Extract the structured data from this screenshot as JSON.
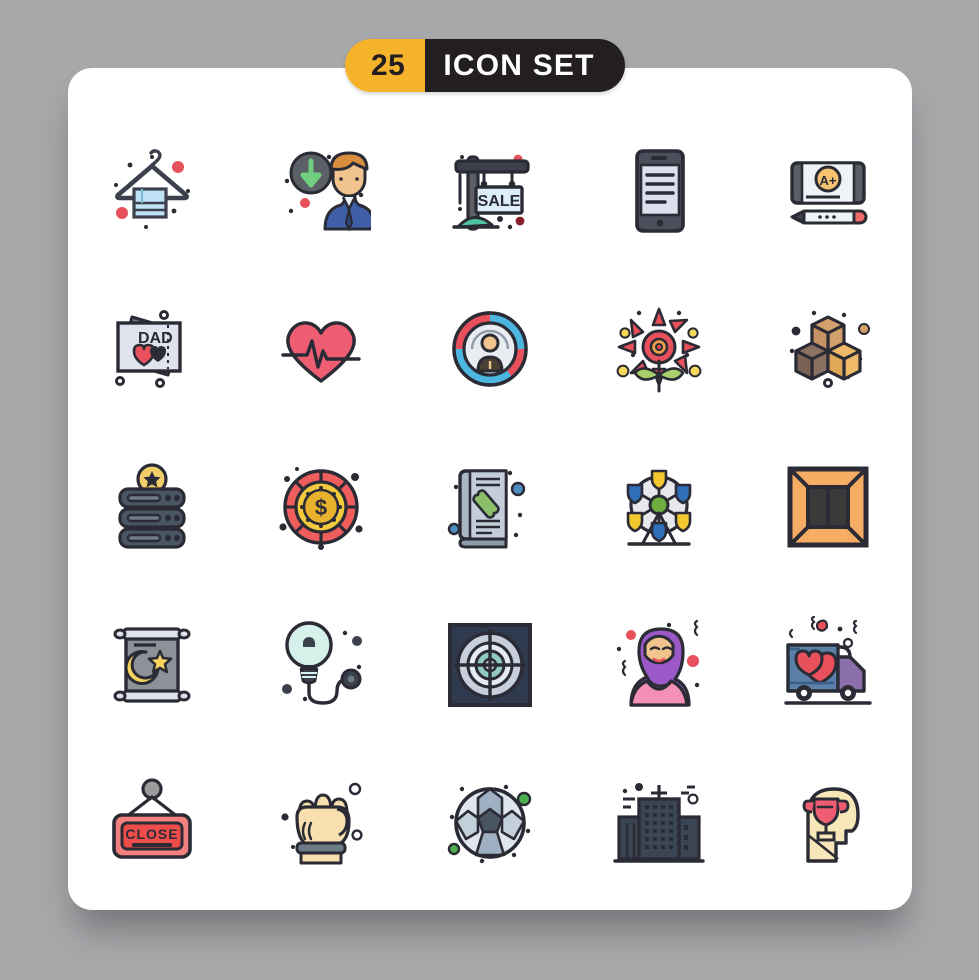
{
  "background_color": "#a7a8aa",
  "card": {
    "background": "#ffffff",
    "corner_radius_px": 24
  },
  "header": {
    "count": "25",
    "title": "Icon Set",
    "title_display": "ICON SET",
    "count_bg": "#f5b32b",
    "title_bg": "#231f20",
    "count_text_color": "#231f20",
    "title_text_color": "#ffffff"
  },
  "style": {
    "name": "Filled Line",
    "stroke_color": "#2b2b35",
    "stroke_width": 2.2
  },
  "grid": {
    "columns": 5,
    "rows": 5,
    "total_icons": 25
  },
  "icons": [
    {
      "id": 1,
      "row": 1,
      "col": 1,
      "name": "hanger-towel-icon",
      "label": "Hanger with Towel",
      "colors": [
        "#3c3f4c",
        "#bfe3f5",
        "#e8505b"
      ]
    },
    {
      "id": 2,
      "row": 1,
      "col": 2,
      "name": "download-businessman-icon",
      "label": "Download Businessman",
      "colors": [
        "#5b6066",
        "#6fcf7e",
        "#3f5fa8",
        "#f2b07b",
        "#e8505b"
      ]
    },
    {
      "id": 3,
      "row": 1,
      "col": 3,
      "name": "sale-signboard-icon",
      "label": "Sale Signboard",
      "sign_text": "SALE",
      "colors": [
        "#3c3f4c",
        "#ddeefb",
        "#4fc3a1"
      ]
    },
    {
      "id": 4,
      "row": 1,
      "col": 4,
      "name": "smartphone-icon",
      "label": "Smartphone Document",
      "colors": [
        "#4a4f5c",
        "#dcdfee"
      ]
    },
    {
      "id": 5,
      "row": 1,
      "col": 5,
      "name": "grade-card-pencil-icon",
      "label": "A+ Grade Card with Pencil",
      "card_text": "A+",
      "colors": [
        "#5b6066",
        "#eef3f7",
        "#f5c271",
        "#e8505b"
      ]
    },
    {
      "id": 6,
      "row": 2,
      "col": 1,
      "name": "dad-card-icon",
      "label": "Dad Card with Hearts",
      "card_text": "DAD",
      "colors": [
        "#5b6066",
        "#dfe3ee",
        "#e8505b"
      ]
    },
    {
      "id": 7,
      "row": 2,
      "col": 2,
      "name": "heartbeat-icon",
      "label": "Heartbeat Pulse",
      "colors": [
        "#ef5d72",
        "#2b2b35"
      ]
    },
    {
      "id": 8,
      "row": 2,
      "col": 3,
      "name": "user-donut-chart-icon",
      "label": "User Profile Chart",
      "colors": [
        "#e8505b",
        "#4bb7e0",
        "#e9edf2",
        "#f2c48d",
        "#4a3f33"
      ]
    },
    {
      "id": 9,
      "row": 2,
      "col": 4,
      "name": "flower-icon",
      "label": "Flower",
      "colors": [
        "#e8505b",
        "#a8cf6a",
        "#f5d958"
      ]
    },
    {
      "id": 10,
      "row": 2,
      "col": 5,
      "name": "sugar-cubes-icon",
      "label": "Sugar Cubes Blocks",
      "colors": [
        "#d2a06a",
        "#f0b96a",
        "#8a7263"
      ]
    },
    {
      "id": 11,
      "row": 3,
      "col": 1,
      "name": "server-star-coin-icon",
      "label": "Server with Star Coin",
      "colors": [
        "#4a5563",
        "#6d7a88",
        "#f2cf6a"
      ]
    },
    {
      "id": 12,
      "row": 3,
      "col": 2,
      "name": "casino-chip-dollar-icon",
      "label": "Casino Chip Dollar",
      "colors": [
        "#ef5d5d",
        "#f3ca3e",
        "#e8b12e"
      ]
    },
    {
      "id": 13,
      "row": 3,
      "col": 3,
      "name": "phone-directory-icon",
      "label": "Phone Directory Book",
      "colors": [
        "#aab6c4",
        "#8e9bab",
        "#8bbf6a",
        "#4f8fc0"
      ]
    },
    {
      "id": 14,
      "row": 3,
      "col": 4,
      "name": "ferris-wheel-icon",
      "label": "Ferris Wheel",
      "colors": [
        "#e6e8ec",
        "#f3c72e",
        "#2f6fba",
        "#6dae3f"
      ]
    },
    {
      "id": 15,
      "row": 3,
      "col": 5,
      "name": "window-frame-icon",
      "label": "Window Frame",
      "colors": [
        "#f5ac63",
        "#3a3a3a"
      ]
    },
    {
      "id": 16,
      "row": 4,
      "col": 1,
      "name": "ramadan-scroll-icon",
      "label": "Moon Star Scroll",
      "colors": [
        "#8d9198",
        "#dfe4ec",
        "#f5d45e"
      ]
    },
    {
      "id": 17,
      "row": 4,
      "col": 2,
      "name": "light-bulb-plug-icon",
      "label": "Light Bulb with Plug",
      "colors": [
        "#d6f0ea",
        "#3c3f4c"
      ]
    },
    {
      "id": 18,
      "row": 4,
      "col": 3,
      "name": "radar-target-icon",
      "label": "Radar Target Screen",
      "colors": [
        "#2f3a4e",
        "#c6cfdb",
        "#8fcbc0"
      ]
    },
    {
      "id": 19,
      "row": 4,
      "col": 4,
      "name": "hijab-woman-icon",
      "label": "Woman in Hijab",
      "colors": [
        "#9b59c8",
        "#f48fb6",
        "#f2c48d",
        "#e8505b"
      ]
    },
    {
      "id": 20,
      "row": 4,
      "col": 5,
      "name": "love-delivery-truck-icon",
      "label": "Love Delivery Truck",
      "colors": [
        "#5a7fa8",
        "#8a6fa8",
        "#e8505b",
        "#2b2b35"
      ]
    },
    {
      "id": 21,
      "row": 5,
      "col": 1,
      "name": "close-sign-icon",
      "label": "Close Hanging Sign",
      "sign_text": "CLOSE",
      "colors": [
        "#ef5d5d",
        "#f58080",
        "#9a9a9a"
      ]
    },
    {
      "id": 22,
      "row": 5,
      "col": 2,
      "name": "fist-hand-icon",
      "label": "Raised Fist",
      "colors": [
        "#f7dfb0",
        "#6d7a88"
      ]
    },
    {
      "id": 23,
      "row": 5,
      "col": 3,
      "name": "soccer-ball-icon",
      "label": "Soccer Ball",
      "colors": [
        "#dfe6ee",
        "#9fb0c2",
        "#4a5563",
        "#4caf50"
      ]
    },
    {
      "id": 24,
      "row": 5,
      "col": 4,
      "name": "city-buildings-icon",
      "label": "City Office Buildings",
      "colors": [
        "#3c4553",
        "#2b2b35"
      ]
    },
    {
      "id": 25,
      "row": 5,
      "col": 5,
      "name": "head-trophy-icon",
      "label": "Head with Trophy",
      "colors": [
        "#f7e6b8",
        "#ef5d72"
      ]
    }
  ]
}
